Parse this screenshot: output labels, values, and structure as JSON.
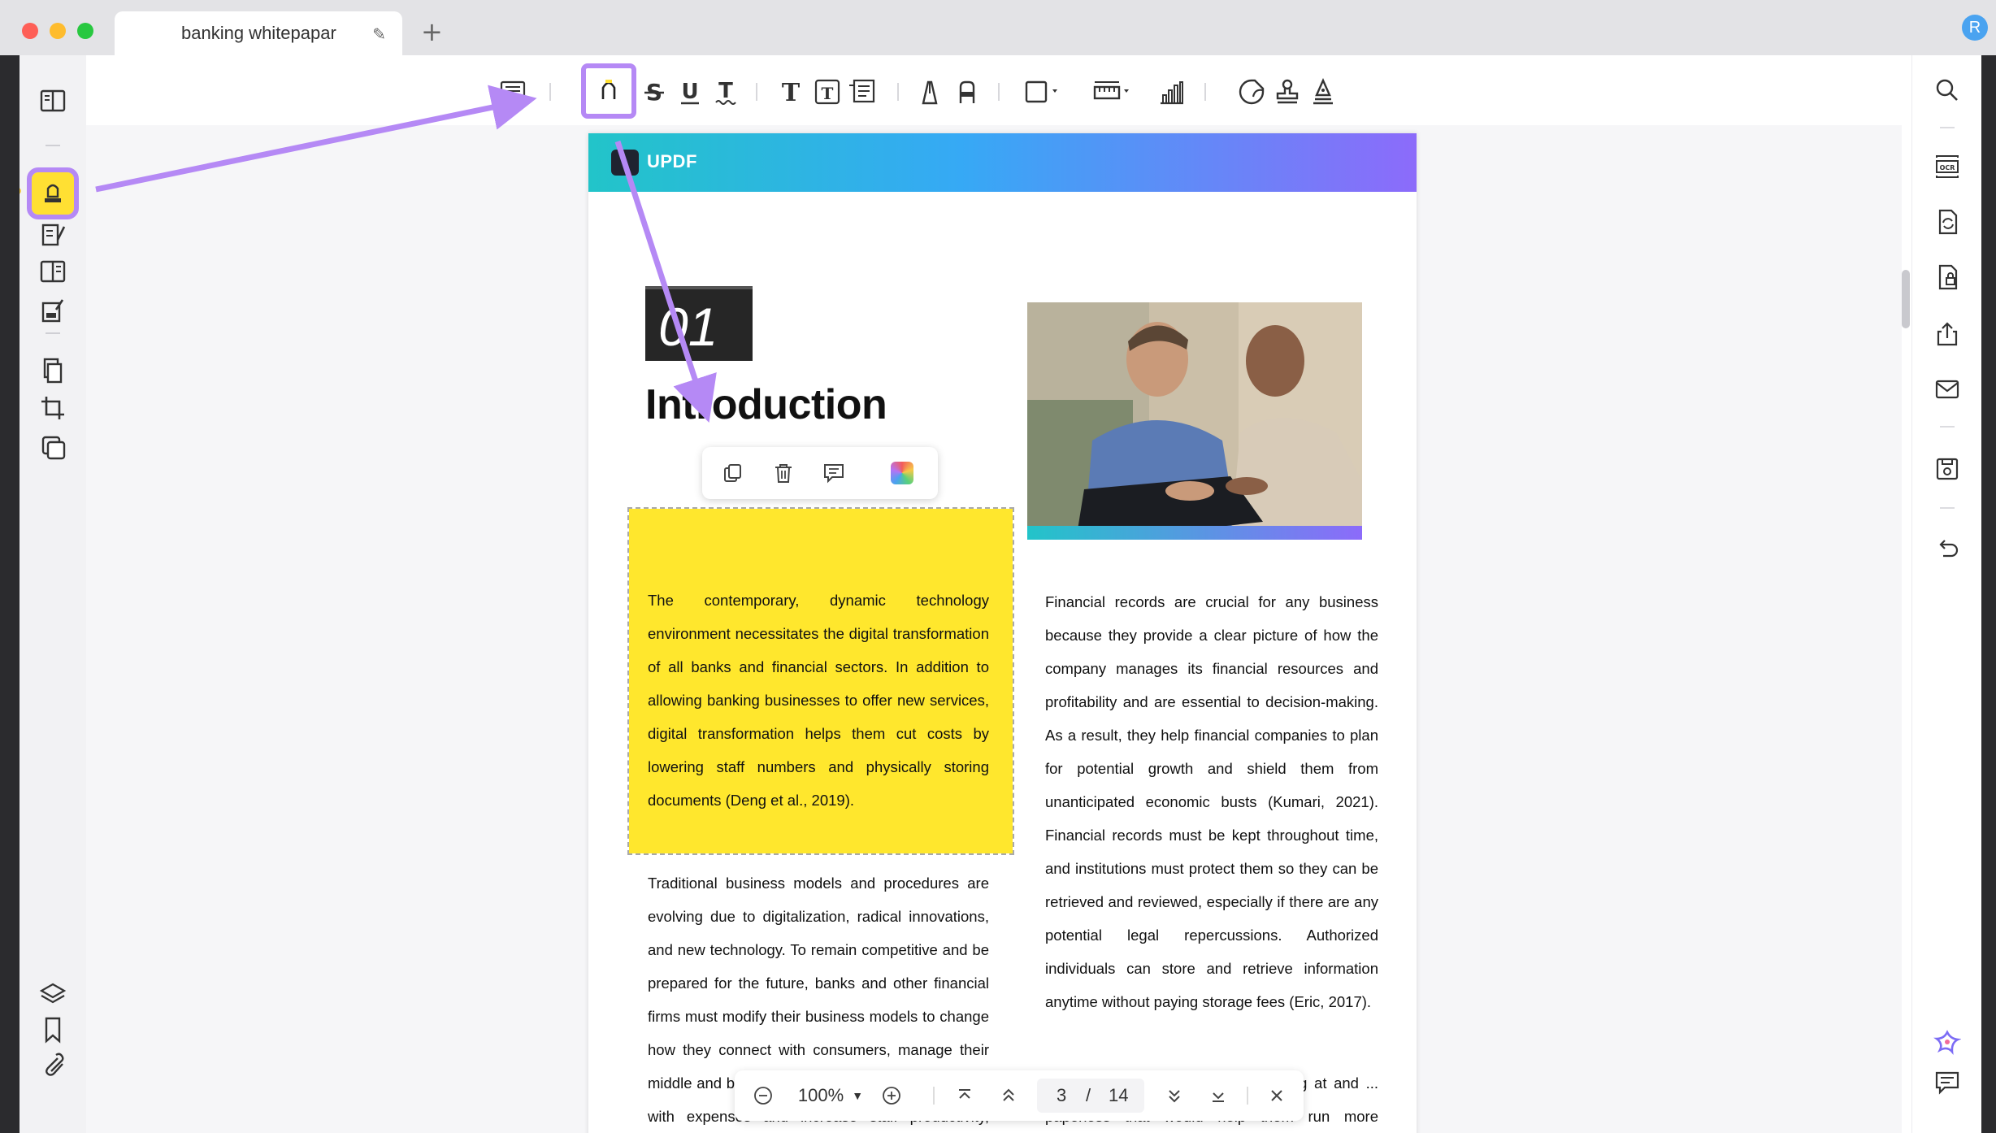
{
  "window": {
    "tab_title": "banking whitepapar",
    "user_initial": "R"
  },
  "document": {
    "brand": "UPDF",
    "chapter_number": "01",
    "chapter_title": "Introduction",
    "highlighted_paragraph": "The contemporary, dynamic technology environment necessitates the digital transformation of all banks and financial sectors. In addition to allowing banking businesses to offer new services, digital transformation helps them cut costs by lowering staff numbers and physically storing documents (Deng et al., 2019).",
    "left_paragraph_2": "Traditional business models and procedures are evolving due to digitalization, radical innovations, and new technology. To remain competitive and be prepared for the future, banks and other financial firms must modify their business models to change how they connect with consumers, manage their middle and back-office activities, and communicate with expenses and increase staff productivity, security",
    "right_paragraph_1": "Financial records are crucial for any business because they provide a clear picture of how the company manages its financial resources and profitability and are essential to decision-making. As a result, they help financial companies to plan for potential growth and shield them from unanticipated economic busts (Kumari, 2021). Financial records must be kept throughout time, and institutions must protect them so they can be retrieved and reviewed, especially if there are any potential legal repercussions. Authorized individuals can store and retrieve information anytime without paying storage fees (Eric, 2017).",
    "right_paragraph_2": "Commercial banks have been looking at and ... paperless that would help them run more efficiently by enhanc-"
  },
  "bottom_nav": {
    "zoom": "100%",
    "current_page": "3",
    "separator": "/",
    "total_pages": "14"
  },
  "icons": {
    "left_sidebar": [
      "reader-icon",
      "comment-highlighter-icon",
      "edit-text-icon",
      "organize-pages-icon",
      "fill-sign-icon",
      "pages-icon",
      "crop-icon",
      "layers-icon",
      "layers-stack-icon",
      "bookmark-icon",
      "attachment-icon"
    ],
    "toolbar": [
      "note-icon",
      "highlighter-icon",
      "strikethrough-icon",
      "underline-icon",
      "squiggly-icon",
      "text-icon",
      "textbox-icon",
      "text-callout-icon",
      "pencil-icon",
      "eraser-icon",
      "shape-icon",
      "measure-icon",
      "chart-icon",
      "sticker-icon",
      "stamp-icon",
      "signature-icon"
    ],
    "right_sidebar": [
      "search-icon",
      "ocr-icon",
      "convert-icon",
      "protect-icon",
      "share-icon",
      "email-icon",
      "save-icon",
      "undo-icon",
      "ai-assistant-icon",
      "comments-icon"
    ],
    "popover": [
      "copy-icon",
      "delete-icon",
      "comment-icon",
      "color-icon"
    ]
  },
  "colors": {
    "accent_purple": "#b589f5",
    "highlight_yellow": "#ffe72d",
    "banner_start": "#22c4c9",
    "banner_end": "#8c6bfa"
  }
}
